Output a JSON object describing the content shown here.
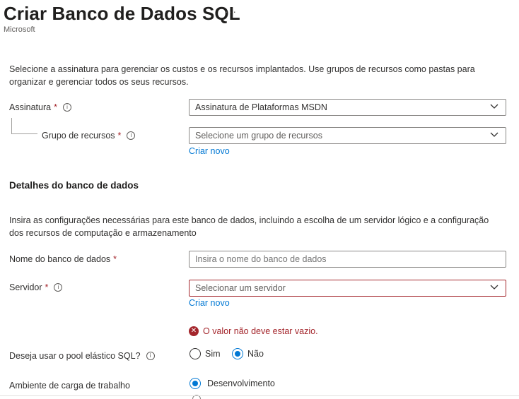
{
  "header": {
    "title": "Criar Banco de Dados SQL",
    "more": "···",
    "publisher": "Microsoft"
  },
  "project": {
    "description": "Selecione a assinatura para gerenciar os custos e os recursos implantados. Use grupos de recursos como pastas para organizar e gerenciar todos os seus recursos.",
    "subscription_label": "Assinatura",
    "subscription_value": "Assinatura de Plataformas MSDN",
    "resource_group_label": "Grupo de recursos",
    "resource_group_placeholder": "Selecione um grupo de recursos",
    "create_new": "Criar novo"
  },
  "details": {
    "title": "Detalhes do banco de dados",
    "description": "Insira as configurações necessárias para este banco de dados, incluindo a escolha de um servidor lógico e a configuração dos recursos de computação e armazenamento",
    "db_name_label": "Nome do banco de dados",
    "db_name_placeholder": "Insira o nome do banco de dados",
    "server_label": "Servidor",
    "server_placeholder": "Selecionar um servidor",
    "server_create_new": "Criar novo",
    "server_error": "O valor não deve estar vazio.",
    "elastic_pool_label": "Deseja usar o pool elástico SQL?",
    "elastic_pool_options": [
      "Sim",
      "Não"
    ],
    "elastic_pool_selected": "Não",
    "workload_label": "Ambiente de carga de trabalho",
    "workload_option": "Desenvolvimento"
  },
  "common": {
    "required_mark": "*",
    "info_glyph": "i",
    "error_glyph": "✕"
  },
  "icons": {
    "chevron": "chevron-down-icon",
    "info": "info-icon",
    "error": "error-icon"
  },
  "colors": {
    "accent": "#0078d4",
    "error": "#a4262c",
    "text": "#323130",
    "border": "#8a8886"
  }
}
